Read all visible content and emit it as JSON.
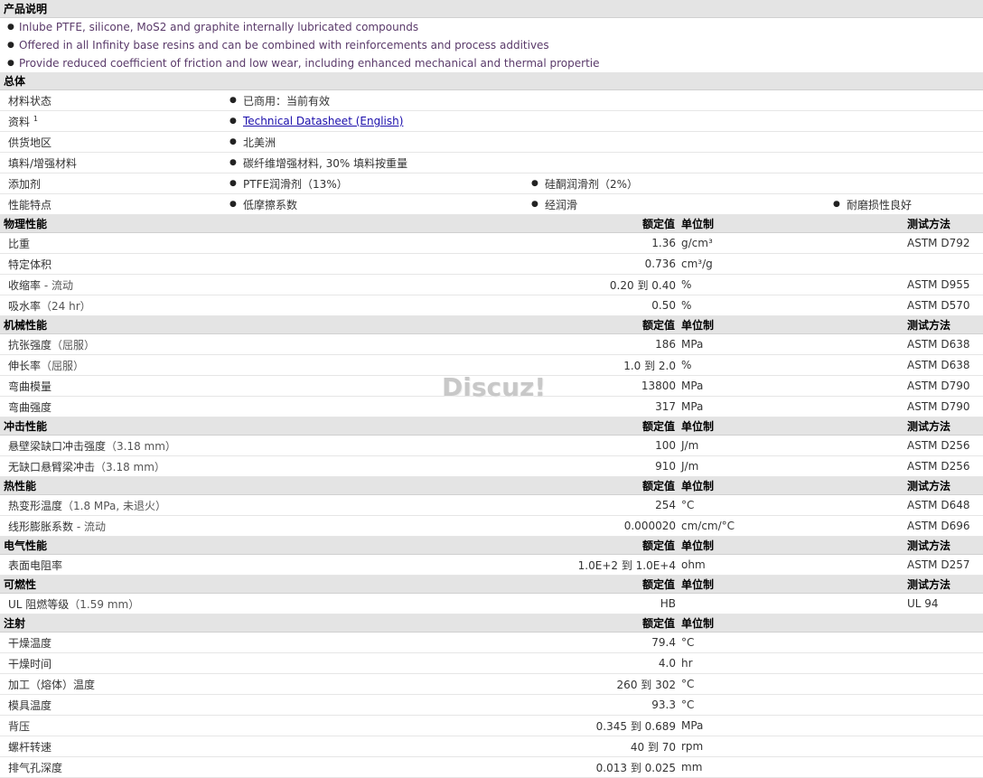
{
  "description": {
    "title": "产品说明",
    "bullets": [
      "Inlube PTFE, silicone, MoS2 and graphite internally lubricated compounds",
      "Offered in all Infinity base resins and can be combined with reinforcements and process additives",
      "Provide reduced coefficient of friction and low wear, including enhanced mechanical and thermal propertie"
    ]
  },
  "general": {
    "title": "总体",
    "rows": [
      {
        "label": "材料状态",
        "items": [
          "已商用：当前有效"
        ]
      },
      {
        "label": "资料",
        "sup": "1",
        "items": [
          "Technical Datasheet (English)"
        ]
      },
      {
        "label": "供货地区",
        "items": [
          "北美洲"
        ]
      },
      {
        "label": "填料/增强材料",
        "items": [
          "碳纤维增强材料, 30% 填料按重量"
        ]
      },
      {
        "label": "添加剂",
        "items": [
          "PTFE润滑剂（13%）",
          "硅酮润滑剂（2%）"
        ]
      },
      {
        "label": "性能特点",
        "items": [
          "低摩擦系数",
          "经润滑",
          "耐磨损性良好"
        ]
      }
    ]
  },
  "headers": {
    "value": "额定值",
    "unit": "单位制",
    "method": "测试方法"
  },
  "sections": [
    {
      "title": "物理性能",
      "rows": [
        {
          "label": "比重",
          "note": "",
          "value": "1.36",
          "unit": "g/cm³",
          "method": "ASTM D792"
        },
        {
          "label": "特定体积",
          "note": "",
          "value": "0.736",
          "unit": "cm³/g",
          "method": ""
        },
        {
          "label": "收缩率",
          "note": " - 流动",
          "value": "0.20 到  0.40",
          "unit": "%",
          "method": "ASTM D955"
        },
        {
          "label": "吸水率",
          "note": "（24 hr）",
          "value": "0.50",
          "unit": "%",
          "method": "ASTM D570"
        }
      ]
    },
    {
      "title": "机械性能",
      "rows": [
        {
          "label": "抗张强度",
          "note": "（屈服）",
          "value": "186",
          "unit": "MPa",
          "method": "ASTM D638"
        },
        {
          "label": "伸长率",
          "note": "（屈服）",
          "value": "1.0 到  2.0",
          "unit": "%",
          "method": "ASTM D638"
        },
        {
          "label": "弯曲模量",
          "note": "",
          "value": "13800",
          "unit": "MPa",
          "method": "ASTM D790"
        },
        {
          "label": "弯曲强度",
          "note": "",
          "value": "317",
          "unit": "MPa",
          "method": "ASTM D790"
        }
      ]
    },
    {
      "title": "冲击性能",
      "rows": [
        {
          "label": "悬壁梁缺口冲击强度",
          "note": "（3.18 mm）",
          "value": "100",
          "unit": "J/m",
          "method": "ASTM D256"
        },
        {
          "label": "无缺口悬臂梁冲击",
          "note": "（3.18 mm）",
          "value": "910",
          "unit": "J/m",
          "method": "ASTM D256"
        }
      ]
    },
    {
      "title": "热性能",
      "rows": [
        {
          "label": "热变形温度",
          "note": "（1.8 MPa, 未退火）",
          "value": "254",
          "unit": "°C",
          "method": "ASTM D648"
        },
        {
          "label": "线形膨胀系数",
          "note": " - 流动",
          "value": "0.000020",
          "unit": "cm/cm/°C",
          "method": "ASTM D696"
        }
      ]
    },
    {
      "title": "电气性能",
      "rows": [
        {
          "label": "表面电阻率",
          "note": "",
          "value": "1.0E+2 到  1.0E+4",
          "unit": "ohm",
          "method": "ASTM D257"
        }
      ]
    },
    {
      "title": "可燃性",
      "rows": [
        {
          "label": "UL 阻燃等级",
          "note": "（1.59 mm）",
          "value": "HB",
          "unit": "",
          "method": "UL 94"
        }
      ]
    },
    {
      "title": "注射",
      "hideMethod": true,
      "rows": [
        {
          "label": "干燥温度",
          "note": "",
          "value": "79.4",
          "unit": "°C",
          "method": ""
        },
        {
          "label": "干燥时间",
          "note": "",
          "value": "4.0",
          "unit": "hr",
          "method": ""
        },
        {
          "label": "加工（熔体）温度",
          "note": "",
          "value": "260 到  302",
          "unit": "°C",
          "method": ""
        },
        {
          "label": "模具温度",
          "note": "",
          "value": "93.3",
          "unit": "°C",
          "method": ""
        },
        {
          "label": "背压",
          "note": "",
          "value": "0.345 到  0.689",
          "unit": "MPa",
          "method": ""
        },
        {
          "label": "螺杆转速",
          "note": "",
          "value": "40 到  70",
          "unit": "rpm",
          "method": ""
        },
        {
          "label": "排气孔深度",
          "note": "",
          "value": "0.013 到  0.025",
          "unit": "mm",
          "method": ""
        }
      ]
    }
  ],
  "watermark": "Discuz!"
}
